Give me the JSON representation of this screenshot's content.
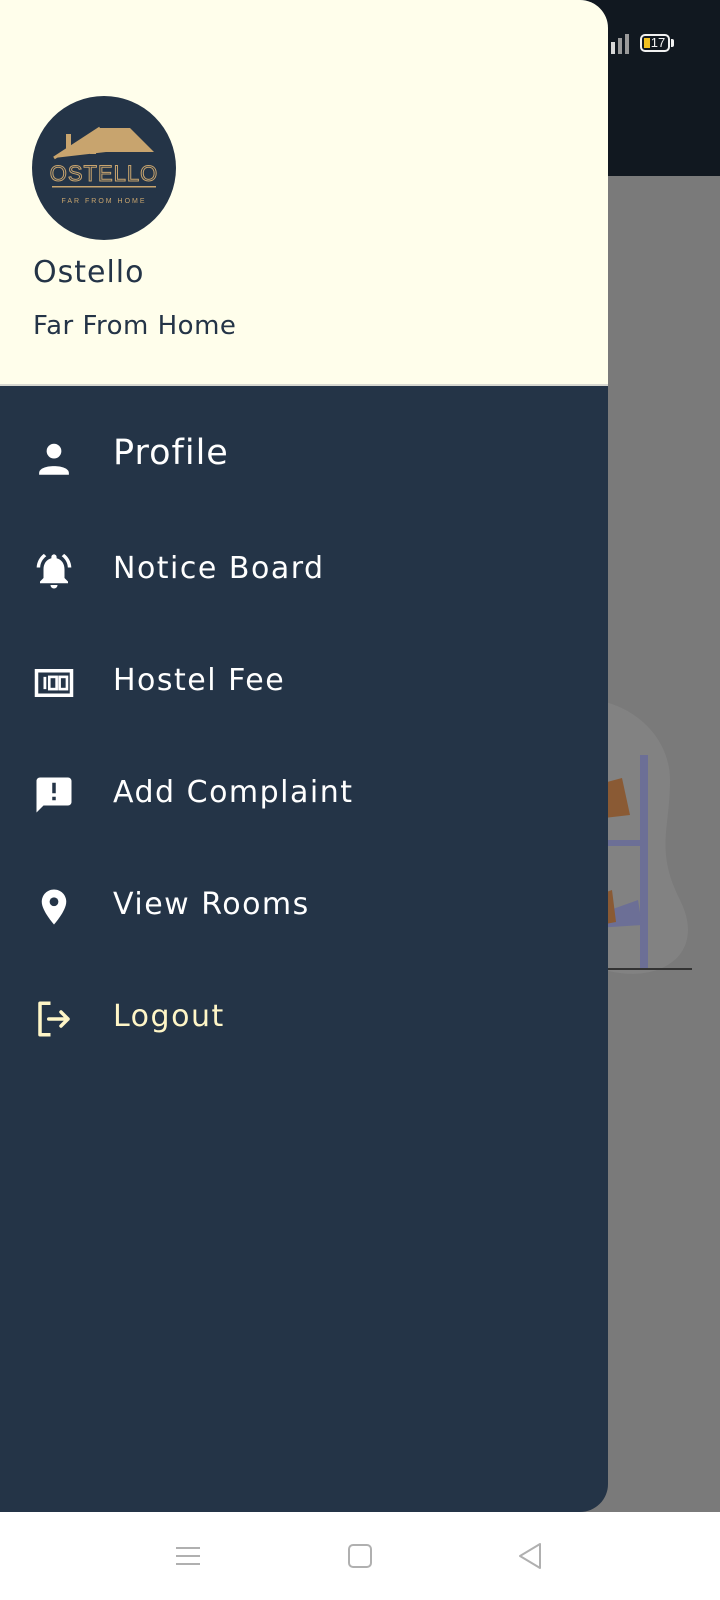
{
  "header": {
    "logo": {
      "brand": "OSTELLO",
      "tagline": "FAR FROM HOME"
    },
    "title": "Ostello",
    "subtitle": "Far From Home"
  },
  "status_bar": {
    "battery": "17"
  },
  "menu": {
    "items": [
      {
        "label": "Profile",
        "icon": "person-icon"
      },
      {
        "label": "Notice Board",
        "icon": "notification-bell-icon"
      },
      {
        "label": "Hostel Fee",
        "icon": "money-100-icon"
      },
      {
        "label": "Add Complaint",
        "icon": "feedback-icon"
      },
      {
        "label": "View Rooms",
        "icon": "location-pin-icon"
      },
      {
        "label": "Logout",
        "icon": "logout-icon"
      }
    ]
  },
  "nav_bar": {
    "buttons": [
      "menu-icon",
      "home-square-icon",
      "back-triangle-icon"
    ]
  },
  "colors": {
    "drawer_bg": "#243447",
    "header_bg": "#fffeeb",
    "logo_gold": "#c8a46e",
    "logout_text": "#fff6c7",
    "scrim": "#7a7a7a"
  }
}
